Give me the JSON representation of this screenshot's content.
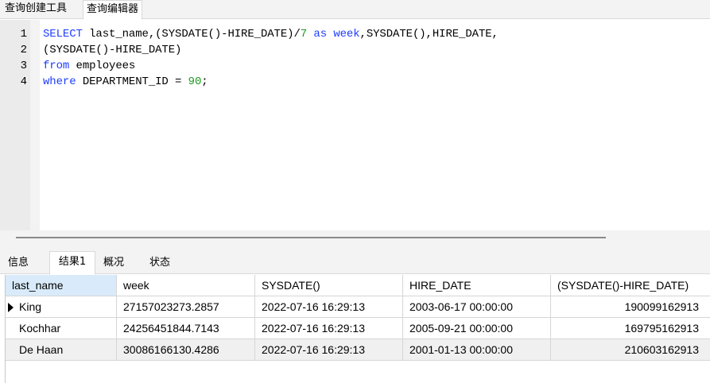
{
  "top_tabs": [
    "查询创建工具",
    "查询编辑器"
  ],
  "editor": {
    "lines": [
      {
        "num": "1",
        "tokens": [
          {
            "t": "SELECT",
            "c": "kw"
          },
          {
            "t": " last_name,(SYSDATE()-HIRE_DATE)/",
            "c": "txt"
          },
          {
            "t": "7",
            "c": "num"
          },
          {
            "t": " ",
            "c": "txt"
          },
          {
            "t": "as",
            "c": "kw"
          },
          {
            "t": " ",
            "c": "txt"
          },
          {
            "t": "week",
            "c": "kw"
          },
          {
            "t": ",SYSDATE(),HIRE_DATE,",
            "c": "txt"
          }
        ]
      },
      {
        "num": "2",
        "tokens": [
          {
            "t": "(SYSDATE()-HIRE_DATE)",
            "c": "txt"
          }
        ]
      },
      {
        "num": "3",
        "tokens": [
          {
            "t": "from",
            "c": "kw"
          },
          {
            "t": " employees",
            "c": "txt"
          }
        ]
      },
      {
        "num": "4",
        "tokens": [
          {
            "t": "where",
            "c": "kw"
          },
          {
            "t": " DEPARTMENT_ID = ",
            "c": "txt"
          },
          {
            "t": "90",
            "c": "num"
          },
          {
            "t": ";",
            "c": "txt"
          }
        ]
      }
    ]
  },
  "result_tabs": [
    "信息",
    "结果1",
    "概况",
    "状态"
  ],
  "grid": {
    "columns": [
      "last_name",
      "week",
      "SYSDATE()",
      "HIRE_DATE",
      "(SYSDATE()-HIRE_DATE)"
    ],
    "rows": [
      [
        "King",
        "27157023273.2857",
        "2022-07-16 16:29:13",
        "2003-06-17 00:00:00",
        "190099162913"
      ],
      [
        "Kochhar",
        "24256451844.7143",
        "2022-07-16 16:29:13",
        "2005-09-21 00:00:00",
        "169795162913"
      ],
      [
        "De Haan",
        "30086166130.4286",
        "2022-07-16 16:29:13",
        "2001-01-13 00:00:00",
        "210603162913"
      ]
    ]
  },
  "colors": {
    "keyword": "#1e3cff",
    "number": "#1a9c1a",
    "header_selected": "#d9ebfa"
  }
}
